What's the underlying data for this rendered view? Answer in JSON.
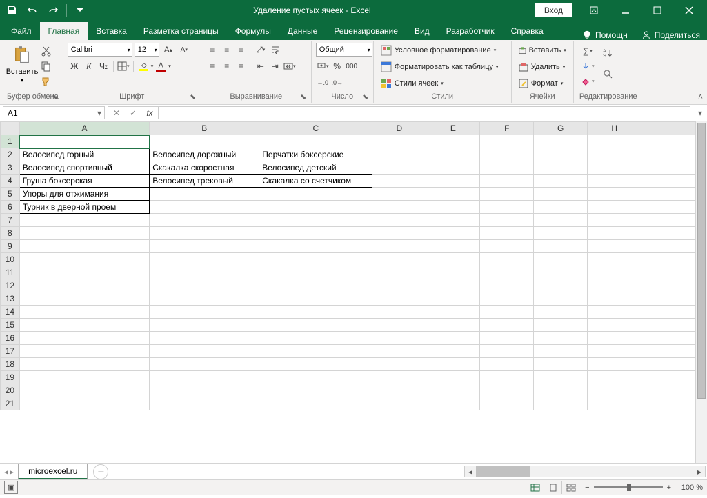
{
  "titlebar": {
    "title": "Удаление пустых ячеек  -  Excel",
    "signin": "Вход"
  },
  "tabs": {
    "file": "Файл",
    "home": "Главная",
    "insert": "Вставка",
    "pagelayout": "Разметка страницы",
    "formulas": "Формулы",
    "data": "Данные",
    "review": "Рецензирование",
    "view": "Вид",
    "developer": "Разработчик",
    "help": "Справка",
    "tell_me": "Помощн",
    "share": "Поделиться"
  },
  "ribbon": {
    "clipboard": {
      "label": "Буфер обмена",
      "paste": "Вставить"
    },
    "font": {
      "label": "Шрифт",
      "name": "Calibri",
      "size": "12",
      "bold": "Ж",
      "italic": "К",
      "underline": "Ч"
    },
    "alignment": {
      "label": "Выравнивание"
    },
    "number": {
      "label": "Число",
      "format": "Общий"
    },
    "styles": {
      "label": "Стили",
      "cond": "Условное форматирование",
      "table": "Форматировать как таблицу",
      "cell": "Стили ячеек"
    },
    "cells": {
      "label": "Ячейки",
      "insert": "Вставить",
      "delete": "Удалить",
      "format": "Формат"
    },
    "editing": {
      "label": "Редактирование"
    }
  },
  "formula": {
    "name_box": "A1",
    "fx": "fx",
    "value": ""
  },
  "columns": [
    "A",
    "B",
    "C",
    "D",
    "E",
    "F",
    "G",
    "H"
  ],
  "cells": {
    "A2": "Велосипед горный",
    "A3": "Велосипед спортивный",
    "A4": "Груша боксерская",
    "A5": "Упоры для отжимания",
    "A6": "Турник в дверной проем",
    "B2": "Велосипед дорожный",
    "B3": "Скакалка скоростная",
    "B4": "Велосипед трековый",
    "C2": "Перчатки боксерские",
    "C3": "Велосипед детский",
    "C4": "Скакалка со счетчиком"
  },
  "sheet_tabs": {
    "tab1": "microexcel.ru"
  },
  "status": {
    "zoom": "100 %"
  }
}
